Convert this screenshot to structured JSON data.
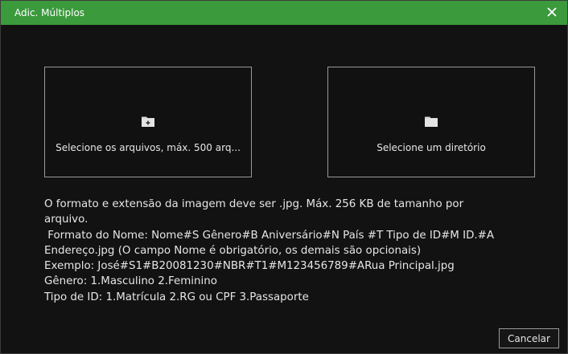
{
  "dialog": {
    "title": "Adic. Múltiplos",
    "colors": {
      "titlebar": "#3b9a3c",
      "background": "#121212",
      "text": "#e6e6e6",
      "border": "#9a9a9a"
    }
  },
  "panels": {
    "files": {
      "label": "Selecione os arquivos, máx. 500 arq...",
      "icon": "folder-add-icon"
    },
    "directory": {
      "label": "Selecione um diretório",
      "icon": "folder-icon"
    }
  },
  "info_lines": [
    "O formato e extensão da imagem deve ser .jpg. Máx. 256 KB de tamanho por",
    "arquivo.",
    " Formato do Nome: Nome#S Gênero#B Aniversário#N País #T Tipo de ID#M ID.#A",
    "Endereço.jpg (O campo Nome é obrigatório, os demais são opcionais)",
    "Exemplo: José#S1#B20081230#NBR#T1#M123456789#ARua Principal.jpg",
    "Gênero: 1.Masculino 2.Feminino",
    "Tipo de ID: 1.Matrícula 2.RG ou CPF 3.Passaporte"
  ],
  "buttons": {
    "cancel": "Cancelar",
    "close_icon": "close-icon"
  }
}
